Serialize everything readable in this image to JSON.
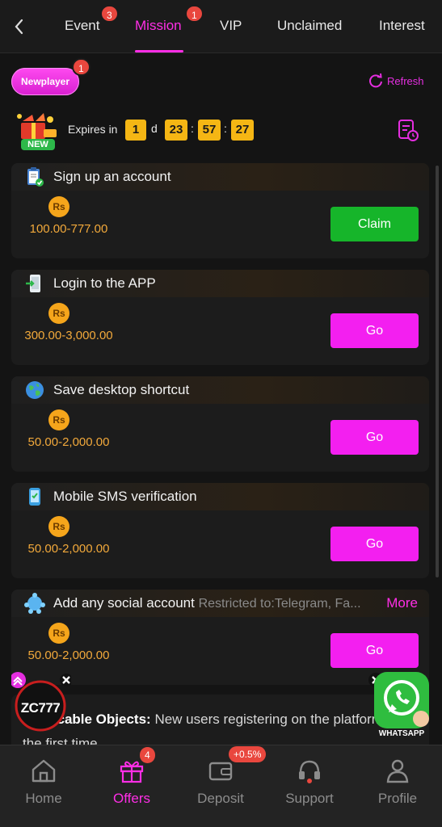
{
  "tabs": [
    {
      "label": "Event",
      "badge": "3"
    },
    {
      "label": "Mission",
      "badge": "1",
      "active": true
    },
    {
      "label": "VIP"
    },
    {
      "label": "Unclaimed"
    },
    {
      "label": "Interest"
    }
  ],
  "subbar": {
    "chip_label": "Newplayer",
    "chip_badge": "1",
    "refresh_label": "Refresh",
    "gift_new_label": "NEW",
    "expires_label": "Expires in",
    "days": "1",
    "days_unit": "d",
    "hours": "23",
    "minutes": "57",
    "seconds": "27"
  },
  "missions": [
    {
      "title": "Sign up an account",
      "currency": "Rs",
      "amount": "100.00-777.00",
      "button": "Claim",
      "icon": "clipboard-icon"
    },
    {
      "title": "Login to the APP",
      "currency": "Rs",
      "amount": "300.00-3,000.00",
      "button": "Go",
      "icon": "phone-login-icon"
    },
    {
      "title": "Save desktop shortcut",
      "currency": "Rs",
      "amount": "50.00-2,000.00",
      "button": "Go",
      "icon": "globe-icon"
    },
    {
      "title": "Mobile SMS verification",
      "currency": "Rs",
      "amount": "50.00-2,000.00",
      "button": "Go",
      "icon": "sms-phone-icon"
    },
    {
      "title": "Add any social account",
      "restriction": "Restricted to:Telegram, Fa...",
      "more": "More",
      "currency": "Rs",
      "amount": "50.00-2,000.00",
      "button": "Go",
      "icon": "social-icon"
    }
  ],
  "applicable": {
    "label": "Applicable Objects:",
    "text": "New users registering on the platform for the first time"
  },
  "floating": {
    "logo_text": "ZC777",
    "whatsapp_label": "WHATSAPP"
  },
  "nav": [
    {
      "label": "Home",
      "icon": "home-icon"
    },
    {
      "label": "Offers",
      "icon": "gift-icon",
      "badge": "4",
      "active": true
    },
    {
      "label": "Deposit",
      "icon": "wallet-icon",
      "badge": "+0.5%"
    },
    {
      "label": "Support",
      "icon": "headset-icon"
    },
    {
      "label": "Profile",
      "icon": "user-icon"
    }
  ],
  "colors": {
    "accent": "#ff2ee6",
    "claim": "#16b52a",
    "go": "#f31ff0",
    "timer": "#f5b614",
    "amount": "#f2a93b"
  }
}
